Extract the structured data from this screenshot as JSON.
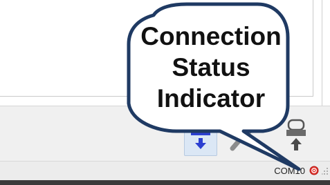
{
  "callout": {
    "lines": [
      "Connection",
      "Status",
      "Indicator"
    ]
  },
  "status_bar": {
    "port_label": "COM10",
    "connection_indicator": "disconnected-red-icon"
  },
  "toolbar": {
    "buttons": [
      {
        "icon": "download-to-device-icon",
        "state": "active"
      },
      {
        "icon": "plug-disconnected-icon",
        "state": "disabled"
      },
      {
        "icon": "upload-from-device-icon",
        "state": "normal"
      }
    ]
  },
  "colors": {
    "callout_border": "#1f3a63",
    "active_button": "#2b3fd1",
    "status_led": "#e0302a"
  }
}
